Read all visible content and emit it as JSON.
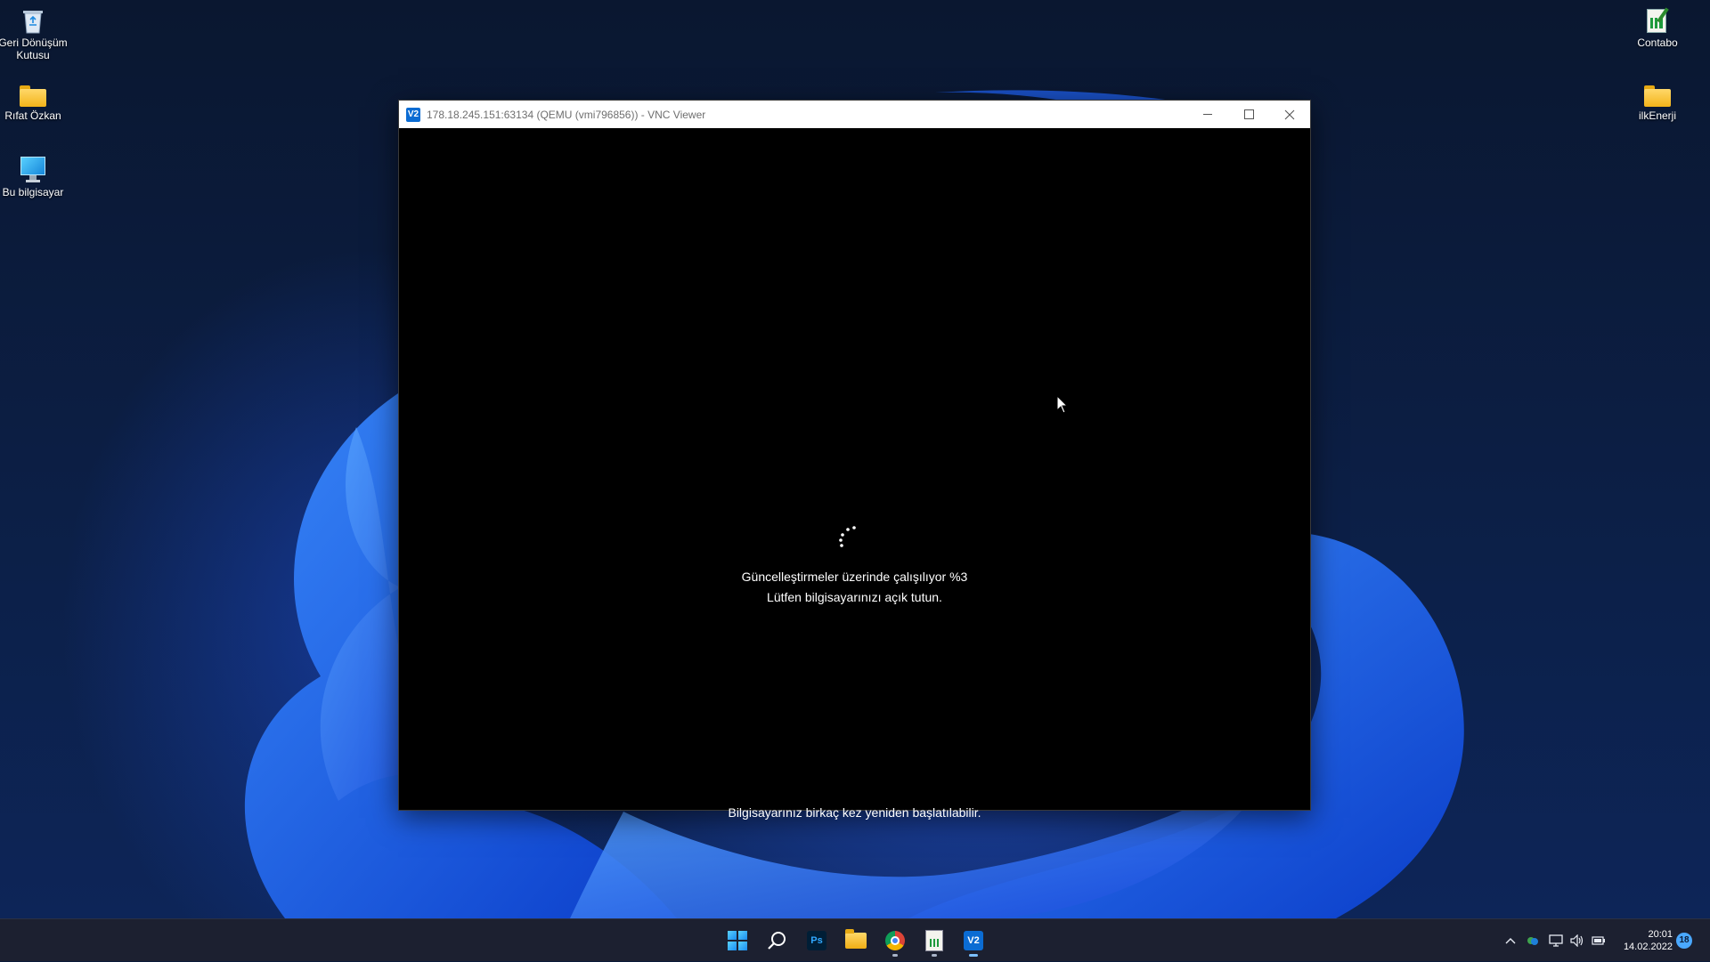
{
  "desktop": {
    "icons_left": [
      {
        "label": "Geri Dönüşüm Kutusu"
      },
      {
        "label": "Rıfat Özkan"
      },
      {
        "label": "Bu bilgisayar"
      }
    ],
    "icons_right": [
      {
        "label": "Contabo"
      },
      {
        "label": "ilkEnerji"
      }
    ]
  },
  "window": {
    "title": "178.18.245.151:63134 (QEMU (vmi796856)) - VNC Viewer",
    "app_icon_text": "V2",
    "controls": {
      "minimize": "minimize-icon",
      "maximize": "maximize-icon",
      "close": "close-icon"
    }
  },
  "update_screen": {
    "line1": "Güncelleştirmeler üzerinde çalışılıyor  %3",
    "line2": "Lütfen bilgisayarınızı açık tutun.",
    "footer": "Bilgisayarınız birkaç kez yeniden başlatılabilir.",
    "progress_percent": 3
  },
  "taskbar": {
    "apps": [
      "start-icon",
      "search-icon",
      "photoshop-icon",
      "file-explorer-icon",
      "chrome-icon",
      "notepad-icon",
      "vnc-viewer-icon"
    ],
    "photoshop_text": "Ps",
    "vnc_text": "V2",
    "tray_icons": [
      "chevron-up-icon",
      "onedrive-icon",
      "network-icon",
      "volume-icon",
      "battery-icon"
    ],
    "time": "20:01",
    "date": "14.02.2022",
    "notification_count": "18"
  },
  "colors": {
    "accent": "#0b6cd3",
    "taskbar": "#1c2030"
  }
}
